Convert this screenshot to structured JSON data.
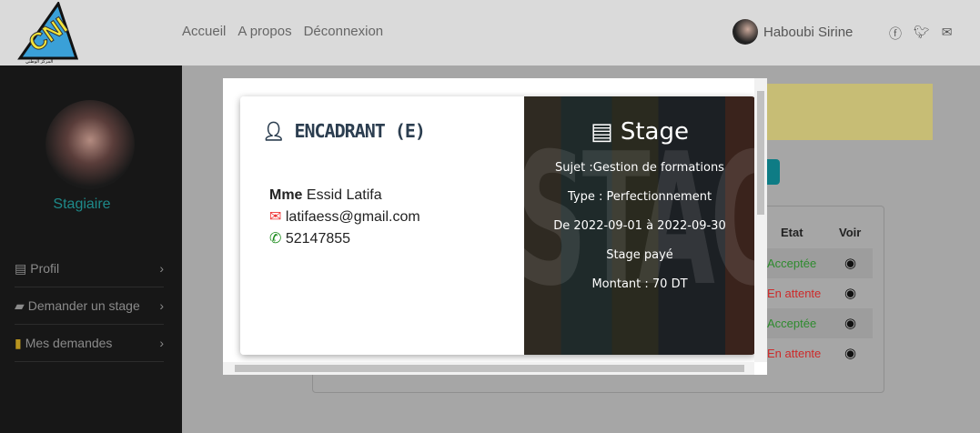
{
  "header": {
    "logo_text": "CNI",
    "logo_subtitle": "المركز الوطني للإعلامية",
    "nav": [
      "Accueil",
      "A propos",
      "Déconnexion"
    ],
    "user_name": "Haboubi Sirine"
  },
  "sidebar": {
    "role": "Stagiaire",
    "items": [
      {
        "label": "Profil"
      },
      {
        "label": "Demander un stage"
      },
      {
        "label": "Mes demandes"
      }
    ]
  },
  "table": {
    "headers": {
      "etat": "Etat",
      "voir": "Voir"
    },
    "rows": [
      {
        "etat": "Acceptée",
        "color": "#2e8b2e"
      },
      {
        "etat": "En attente",
        "color": "#cc2b2b"
      },
      {
        "etat": "Acceptée",
        "color": "#2e8b2e"
      },
      {
        "etat": "En attente",
        "color": "#cc2b2b"
      }
    ]
  },
  "modal": {
    "encadrant_title": "ENCADRANT (E)",
    "title_prefix": "Mme",
    "name": "Essid Latifa",
    "email": "latifaess@gmail.com",
    "phone": "52147855",
    "stage_title": "Stage",
    "watermark": "STAGE",
    "sujet": "Sujet :Gestion de formations",
    "type": "Type : Perfectionnement",
    "dates": "De 2022-09-01 à 2022-09-30",
    "paye": "Stage payé",
    "montant": "Montant : 70 DT"
  }
}
